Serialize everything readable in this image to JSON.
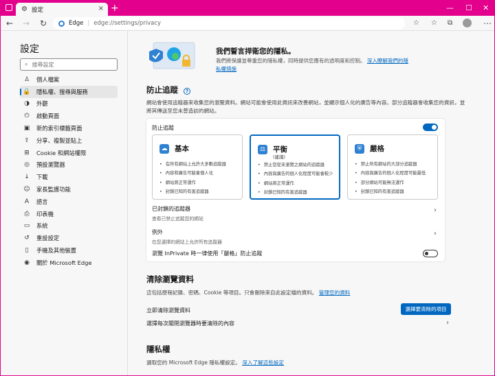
{
  "tab": {
    "title": "設定"
  },
  "address": {
    "site": "Edge",
    "url": "edge://settings/privacy"
  },
  "sidebar": {
    "title": "設定",
    "search_placeholder": "搜尋設定",
    "items": [
      {
        "icon": "person-icon",
        "glyph": "♙",
        "label": "個人檔案"
      },
      {
        "icon": "lock-icon",
        "glyph": "🔒",
        "label": "隱私權、搜尋與服務"
      },
      {
        "icon": "appearance-icon",
        "glyph": "◑",
        "label": "外觀"
      },
      {
        "icon": "power-icon",
        "glyph": "⏻",
        "label": "啟動頁面"
      },
      {
        "icon": "newtab-icon",
        "glyph": "▣",
        "label": "新的索引標籤頁面"
      },
      {
        "icon": "share-icon",
        "glyph": "⇪",
        "label": "分享、複製並貼上"
      },
      {
        "icon": "cookie-icon",
        "glyph": "⊞",
        "label": "Cookie 和網站權限"
      },
      {
        "icon": "browser-icon",
        "glyph": "◎",
        "label": "預設瀏覽器"
      },
      {
        "icon": "download-icon",
        "glyph": "↓",
        "label": "下載"
      },
      {
        "icon": "family-icon",
        "glyph": "☺",
        "label": "家長監護功能"
      },
      {
        "icon": "language-icon",
        "glyph": "A",
        "label": "語言"
      },
      {
        "icon": "printer-icon",
        "glyph": "⎙",
        "label": "印表機"
      },
      {
        "icon": "system-icon",
        "glyph": "▭",
        "label": "系統"
      },
      {
        "icon": "reset-icon",
        "glyph": "↺",
        "label": "重設設定"
      },
      {
        "icon": "phone-icon",
        "glyph": "▯",
        "label": "手機及其他裝置"
      },
      {
        "icon": "edge-icon",
        "glyph": "◉",
        "label": "關於 Microsoft Edge"
      }
    ],
    "selected_index": 1
  },
  "hero": {
    "title": "我們誓言捍衛您的隱私。",
    "desc": "我們將保護並尊重您的隱私權，同時提供您應有的透明度和控制。",
    "link": "深入瞭解我們的隱私權措施"
  },
  "tracking": {
    "heading": "防止追蹤",
    "desc": "網站會使用追蹤器來收集您的瀏覽資料。網站可能會使用此資訊來改善網站，並顯示個人化的廣告等內容。部分追蹤器會收集您的資訊，並將其傳送至您未曾造訪的網站。",
    "toggle_label": "防止追蹤",
    "toggle_on": true,
    "options": [
      {
        "title": "基本",
        "subtitle": "",
        "bullets": [
          "在所有網站上允許大多數追蹤器",
          "內容和廣告可能會個人化",
          "網站將正常運作",
          "封鎖已知的有害追蹤器"
        ]
      },
      {
        "title": "平衡",
        "subtitle": "(建議)",
        "bullets": [
          "禁止您從未瀏覽之網站的追蹤器",
          "內容與廣告的個人化程度可能會較少",
          "網站將正常運作",
          "封鎖已知的有害追蹤器"
        ]
      },
      {
        "title": "嚴格",
        "subtitle": "",
        "bullets": [
          "禁止所有網站的大部分追蹤器",
          "內容與廣告的個人化程度可能最低",
          "部分網站可能無法運作",
          "封鎖已知的有害追蹤器"
        ]
      }
    ],
    "selected": 1,
    "blocked": {
      "title": "已封鎖的追蹤器",
      "sub": "查看已禁止追蹤您的網站"
    },
    "exceptions": {
      "title": "例外",
      "sub": "在您選擇的網站上允許所有追蹤器"
    },
    "inprivate": {
      "label": "瀏覽 InPrivate 時一律使用「嚴格」防止追蹤",
      "on": false
    }
  },
  "clear": {
    "heading": "清除瀏覽資料",
    "desc": "這包括歷程記錄、密碼、Cookie 等項目。只會刪除來自此設定檔的資料。",
    "link": "管理您的資料",
    "now_label": "立即清除瀏覽資料",
    "button": "選擇要清除的項目",
    "close_label": "選擇每次關閉瀏覽器時要清除的內容"
  },
  "privacy": {
    "heading": "隱私權",
    "desc": "選取您的 Microsoft Edge 隱私權設定。",
    "link": "深入了解這些設定"
  }
}
